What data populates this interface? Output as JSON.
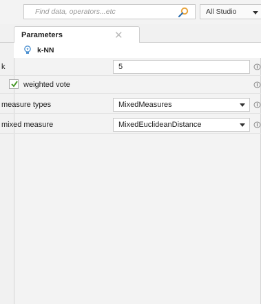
{
  "search": {
    "placeholder": "Find data, operators...etc"
  },
  "studio_dropdown": {
    "label": "All Studio"
  },
  "tabs": [
    {
      "label": "Parameters",
      "close": "✕"
    }
  ],
  "operator": {
    "name": "k-NN",
    "icon": "lightbulb-icon"
  },
  "parameters": {
    "k": {
      "label": "k",
      "value": "5"
    },
    "weighted_vote": {
      "label": "weighted vote",
      "checked": true
    },
    "measure_types": {
      "label": "measure types",
      "value": "MixedMeasures"
    },
    "mixed_measure": {
      "label": "mixed measure",
      "value": "MixedEuclideanDistance"
    }
  },
  "colors": {
    "accent_check": "#4a9a2a",
    "search_icon": "#e8a33a"
  }
}
